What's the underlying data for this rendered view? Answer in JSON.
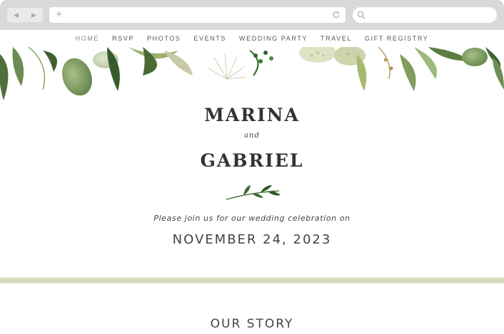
{
  "browser": {
    "back_icon": "back-arrow-icon",
    "forward_icon": "forward-arrow-icon",
    "new_tab_icon": "plus-icon",
    "reload_icon": "reload-icon",
    "search_icon": "search-icon",
    "address_value": "",
    "search_value": ""
  },
  "nav": {
    "items": [
      {
        "label": "HOME"
      },
      {
        "label": "RSVP"
      },
      {
        "label": "PHOTOS"
      },
      {
        "label": "EVENTS"
      },
      {
        "label": "WEDDING PARTY"
      },
      {
        "label": "TRAVEL"
      },
      {
        "label": "GIFT REGISTRY"
      }
    ]
  },
  "hero": {
    "name_one": "MARINA",
    "connector": "and",
    "name_two": "GABRIEL",
    "invitation": "Please join us for our wedding celebration on",
    "date": "NOVEMBER 24, 2023"
  },
  "sections": {
    "story_title": "OUR STORY"
  },
  "colors": {
    "accent_green": "#6f8f4e",
    "text": "#333333",
    "chrome": "#d9d9d9"
  }
}
